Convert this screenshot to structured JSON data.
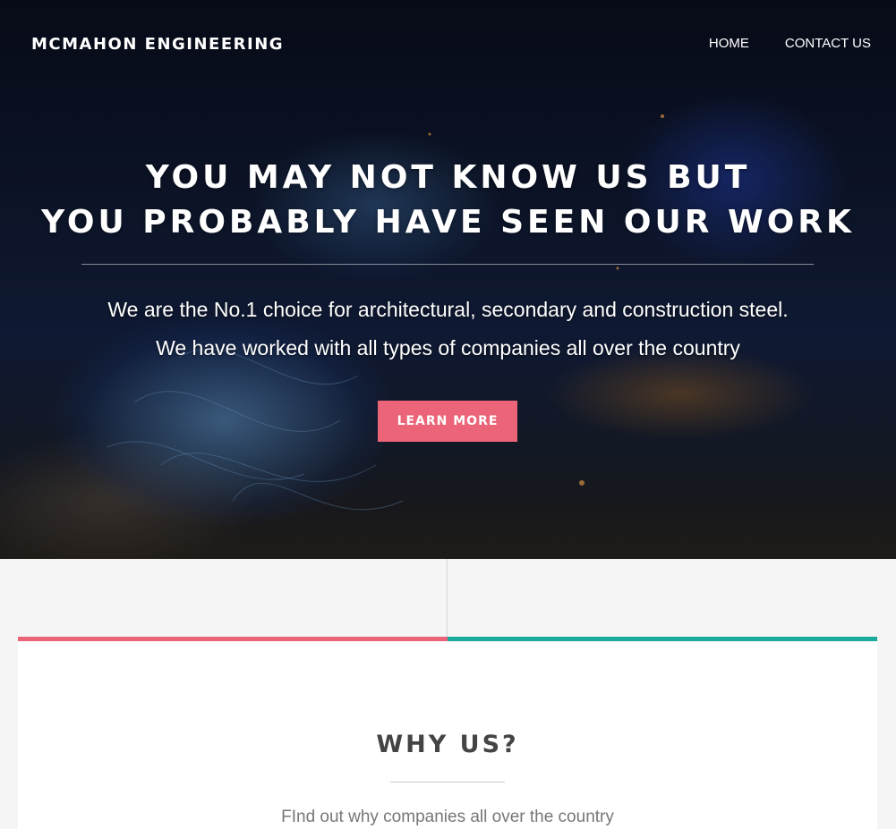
{
  "header": {
    "brand": "MCMAHON ENGINEERING",
    "nav": [
      {
        "label": "HOME"
      },
      {
        "label": "CONTACT US"
      }
    ]
  },
  "hero": {
    "headline_line1": "YOU MAY NOT KNOW US BUT",
    "headline_line2": "YOU PROBABLY HAVE SEEN OUR WORK",
    "subtext_line1": "We are the No.1 choice for architectural, secondary and construction steel.",
    "subtext_line2": "We have worked with all types of companies all over the country",
    "cta_label": "LEARN MORE"
  },
  "why_section": {
    "title": "WHY US?",
    "subtitle": "FInd out why companies all over the country"
  },
  "colors": {
    "accent_pink": "#ec6478",
    "accent_teal": "#1aa99a"
  }
}
